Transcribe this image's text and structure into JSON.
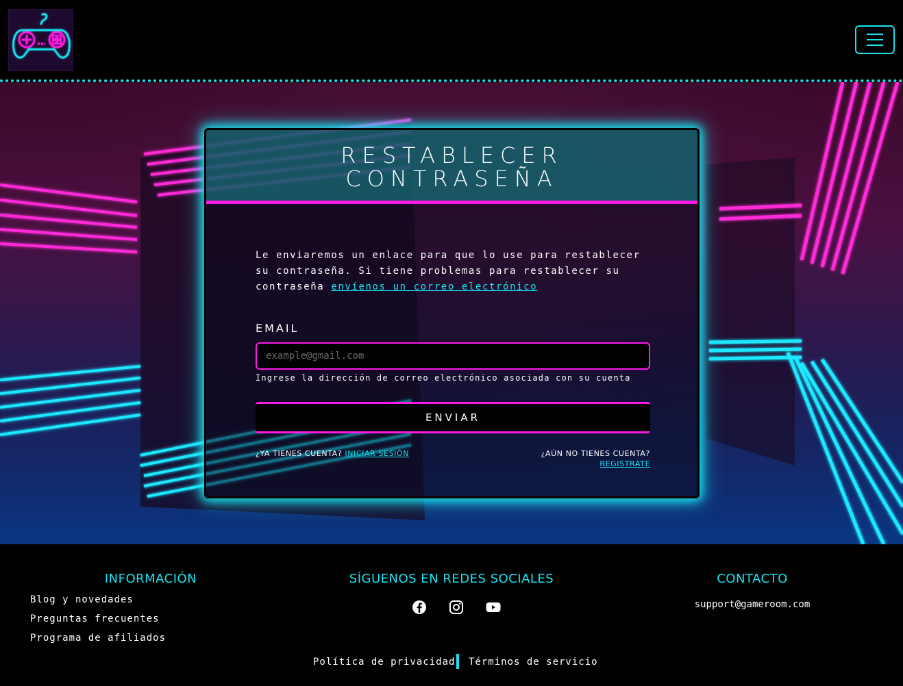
{
  "header": {
    "logo_alt": "GameRoom logo",
    "menu_icon": "hamburger-menu-icon"
  },
  "card": {
    "title_line1": "RESTABLECER",
    "title_line2": "CONTRASEÑA",
    "description": "Le enviaremos un enlace para que lo use para restablecer su contraseña. Si tiene problemas para restablecer su contraseña ",
    "description_link": "envíenos un correo electrónico",
    "email_label": "EMAIL",
    "email_placeholder": "example@gmail.com",
    "email_value": "",
    "email_help": "Ingrese la dirección de correo electrónico asociada con su cuenta",
    "submit_label": "ENVIAR",
    "login_prompt": "¿YA TIENES CUENTA? ",
    "login_link": "INICIAR SESIÓN",
    "register_prompt": "¿AÚN NO TIENES CUENTA?",
    "register_link": "REGISTRATE"
  },
  "footer": {
    "info_heading": "INFORMACIÓN",
    "info_links": [
      "Blog y novedades",
      "Preguntas frecuentes",
      "Programa de afiliados"
    ],
    "social_heading": "SÍGUENOS EN REDES SOCIALES",
    "social_icons": [
      "facebook-icon",
      "instagram-icon",
      "youtube-icon"
    ],
    "contact_heading": "CONTACTO",
    "contact_email": "support@gameroom.com",
    "privacy_link": "Política de privacidad",
    "terms_link": "Términos de servicio"
  },
  "colors": {
    "accent_cyan": "#19e3f0",
    "accent_magenta": "#ff1ae6",
    "background": "#000000"
  }
}
